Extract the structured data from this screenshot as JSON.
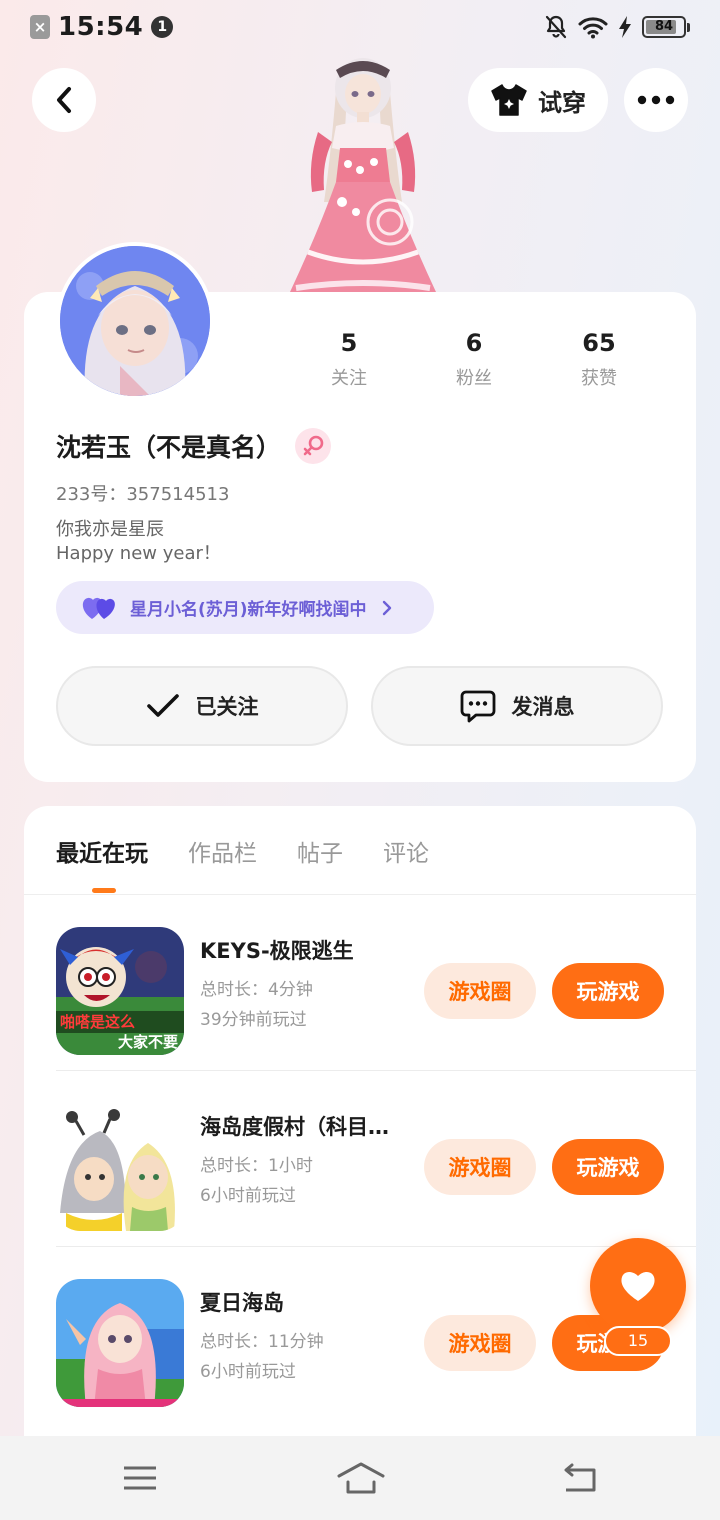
{
  "status_bar": {
    "time": "15:54",
    "notification_count": "1",
    "battery": "84",
    "battery_level": 0.84
  },
  "header": {
    "try_on_label": "试穿"
  },
  "profile": {
    "stats": [
      {
        "value": "5",
        "label": "关注"
      },
      {
        "value": "6",
        "label": "粉丝"
      },
      {
        "value": "65",
        "label": "获赞"
      }
    ],
    "username": "沈若玉（不是真名）",
    "gender": "female",
    "uid": "233号：357514513",
    "bio_line1": "你我亦是星辰",
    "bio_line2": "Happy new year！",
    "cp_text": "星月小名(苏月)新年好啊找闺中",
    "follow_label": "已关注",
    "message_label": "发消息"
  },
  "tabs": [
    {
      "label": "最近在玩",
      "active": true
    },
    {
      "label": "作品栏",
      "active": false
    },
    {
      "label": "帖子",
      "active": false
    },
    {
      "label": "评论",
      "active": false
    }
  ],
  "games": [
    {
      "name": "KEYS-极限逃生",
      "duration": "总时长：4分钟",
      "last_played": "39分钟前玩过",
      "circle_label": "游戏圈",
      "play_label": "玩游戏",
      "icon_text_1": "啪嗒是这么",
      "icon_text_2": "大家不要"
    },
    {
      "name": "海岛度假村（科目…",
      "duration": "总时长：1小时",
      "last_played": "6小时前玩过",
      "circle_label": "游戏圈",
      "play_label": "玩游戏"
    },
    {
      "name": "夏日海岛",
      "duration": "总时长：11分钟",
      "last_played": "6小时前玩过",
      "circle_label": "游戏圈",
      "play_label": "玩游戏"
    }
  ],
  "fab": {
    "count": "15"
  },
  "colors": {
    "accent": "#ff6e14",
    "accent_light": "#fde9dd",
    "cp_purple": "#6c5fd6"
  }
}
